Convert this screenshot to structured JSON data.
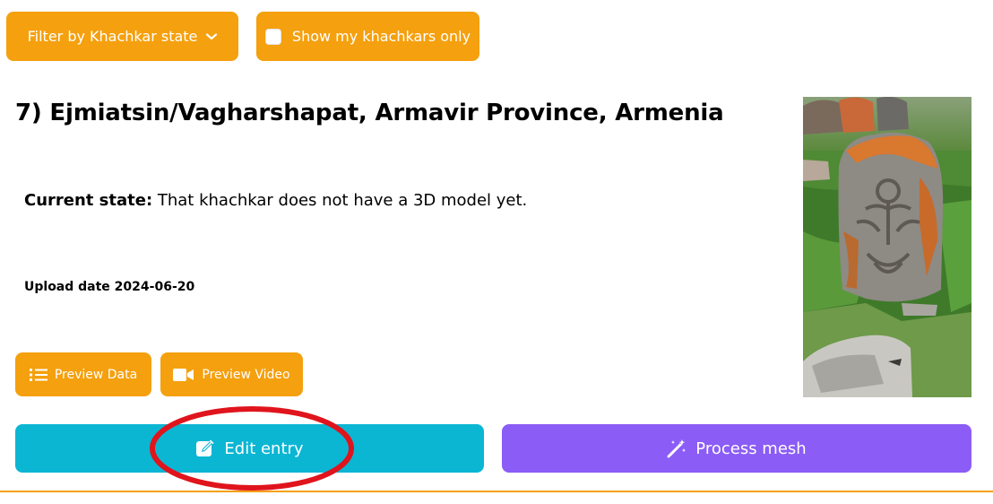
{
  "filters": {
    "state_filter_label": "Filter by Khachkar state",
    "my_only_label": "Show my khachkars only",
    "my_only_checked": false
  },
  "entry": {
    "title": "7) Ejmiatsin/Vagharshapat, Armavir Province, Armenia",
    "state_label": "Current state:",
    "state_value": " That khachkar does not have a 3D model yet.",
    "upload_date": "Upload date 2024-06-20"
  },
  "buttons": {
    "preview_data": "Preview Data",
    "preview_video": "Preview Video",
    "edit_entry": "Edit entry",
    "process_mesh": "Process mesh"
  },
  "icons": {
    "filter": "chevron-down-icon",
    "preview_data": "list-icon",
    "preview_video": "video-camera-icon",
    "edit_entry": "pen-square-icon",
    "process_mesh": "magic-wand-icon"
  },
  "colors": {
    "orange": "#f5a00e",
    "cyan": "#0bb6d3",
    "purple": "#8b5cf6",
    "annotation_red": "#e0141c"
  }
}
